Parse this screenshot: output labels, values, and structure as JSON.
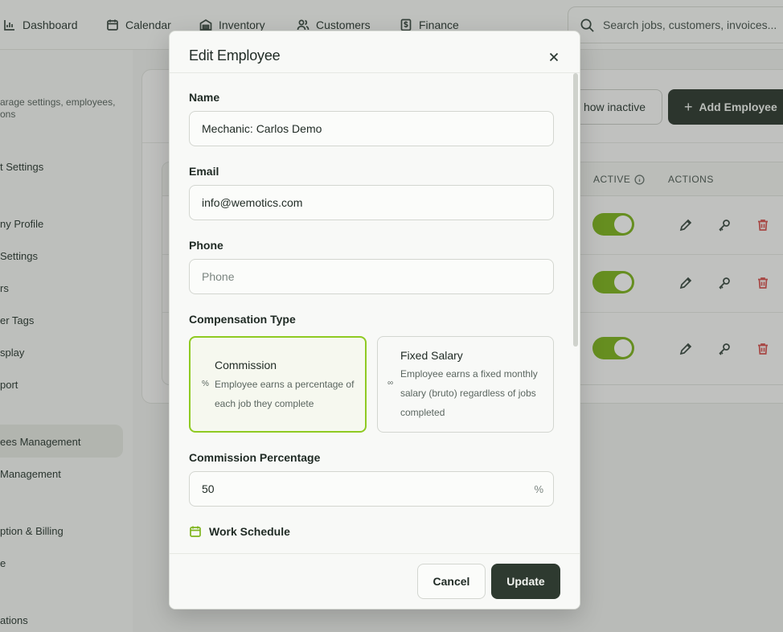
{
  "nav": {
    "items": [
      {
        "label": "Dashboard",
        "icon": "chart-icon"
      },
      {
        "label": "Calendar",
        "icon": "calendar-icon"
      },
      {
        "label": "Inventory",
        "icon": "warehouse-icon"
      },
      {
        "label": "Customers",
        "icon": "users-icon"
      },
      {
        "label": "Finance",
        "icon": "dollar-file-icon"
      }
    ],
    "search_placeholder": "Search jobs, customers, invoices..."
  },
  "sidebar": {
    "description_line1": "arage settings, employees,",
    "description_line2": "ons",
    "items": [
      "t Settings",
      "ny Profile",
      "Settings",
      "rs",
      "er Tags",
      "splay",
      "port",
      "ees Management",
      "Management",
      "ption & Billing",
      "e",
      "ations"
    ],
    "active_item": "ees Management"
  },
  "panel": {
    "show_inactive_label": "how inactive",
    "add_employee_label": "Add Employee",
    "columns": [
      "ACTIVE",
      "ACTIONS"
    ],
    "rows_active": [
      true,
      true,
      true
    ]
  },
  "modal": {
    "title": "Edit Employee",
    "name_label": "Name",
    "name_value": "Mechanic: Carlos Demo",
    "email_label": "Email",
    "email_value": "info@wemotics.com",
    "phone_label": "Phone",
    "phone_placeholder": "Phone",
    "comp_type_label": "Compensation Type",
    "comp_options": [
      {
        "title": "Commission",
        "symbol": "%",
        "desc_lines": [
          "Employee earns a percentage of",
          "each job they complete"
        ],
        "selected": true
      },
      {
        "title": "Fixed Salary",
        "symbol": "∞",
        "desc_lines": [
          "Employee earns a fixed monthly",
          "salary (bruto) regardless of jobs",
          "completed"
        ],
        "selected": false
      }
    ],
    "commission_label": "Commission Percentage",
    "commission_value": "50",
    "commission_suffix": "%",
    "schedule_label": "Work Schedule",
    "cancel_label": "Cancel",
    "update_label": "Update"
  },
  "colors": {
    "accent_green": "#7fb51e",
    "dark_button": "#2e3a30",
    "danger": "#d9534f"
  }
}
